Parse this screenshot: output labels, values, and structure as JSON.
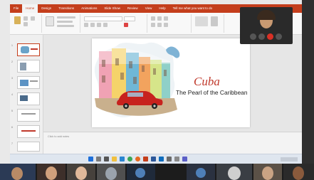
{
  "ribbon": {
    "tabs": [
      "File",
      "Home",
      "Design",
      "Transitions",
      "Animations",
      "Slide Show",
      "Review",
      "View",
      "Help",
      "Tell me what you want to do"
    ],
    "active_tab": "Home",
    "accent_color": "#c43e1c"
  },
  "slide": {
    "title": "Cuba",
    "subtitle": "The Pearl of the Caribbean",
    "title_color": "#c0392b"
  },
  "thumbnails": {
    "numbers": [
      "1",
      "2",
      "3",
      "4",
      "5",
      "6",
      "7"
    ],
    "selected": 0
  },
  "notes": {
    "placeholder": "Click to add notes"
  },
  "icons": {
    "taskbar": [
      "windows-start-icon",
      "search-icon",
      "task-view-icon",
      "file-explorer-icon",
      "edge-icon",
      "chrome-icon",
      "firefox-icon",
      "powerpoint-icon",
      "word-icon",
      "outlook-icon",
      "store-icon",
      "settings-icon",
      "teams-icon"
    ],
    "video_controls": [
      "mic-icon",
      "camera-icon",
      "end-call-icon",
      "share-screen-icon"
    ]
  }
}
